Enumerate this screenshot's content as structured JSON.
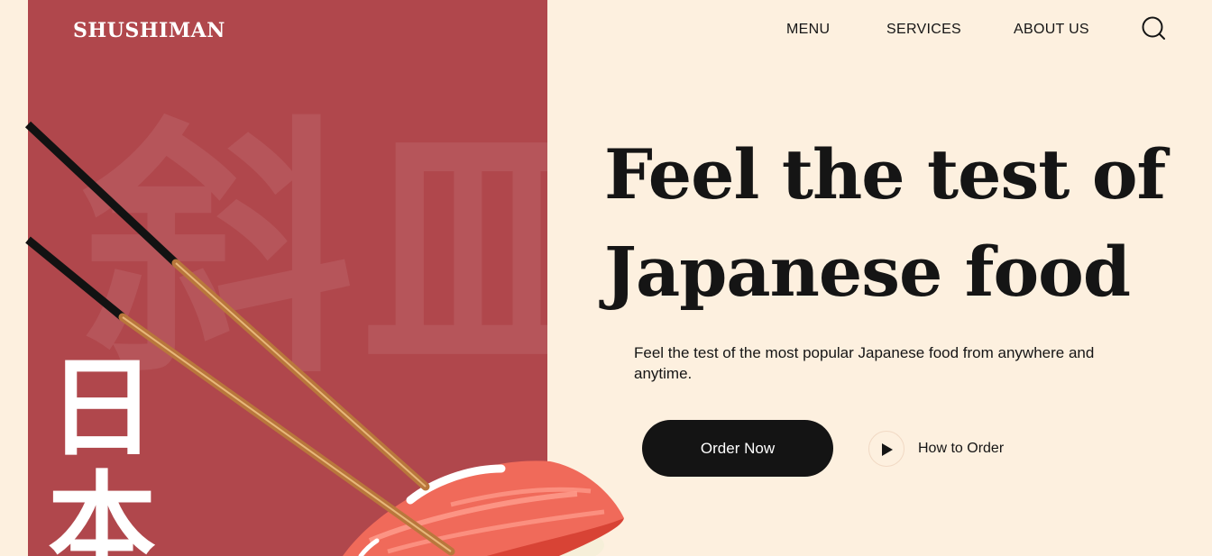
{
  "brand": {
    "logo": "SHUSHIMAN"
  },
  "nav": {
    "items": [
      {
        "label": "MENU"
      },
      {
        "label": "SERVICES"
      },
      {
        "label": "ABOUT US"
      }
    ],
    "search_icon": "search-icon"
  },
  "decor": {
    "background_kanji_1": "斜",
    "background_kanji_2": "皿",
    "vertical_kanji": [
      "日",
      "本"
    ]
  },
  "hero": {
    "title_line_1": "Feel the test of",
    "title_line_2": "Japanese food",
    "subtitle": "Feel the test of the most popular Japanese food from anywhere and anytime.",
    "primary_button": "Order Now",
    "secondary_link": "How to Order",
    "play_icon": "play-icon"
  },
  "colors": {
    "background": "#fdf0df",
    "panel": "#b0474c",
    "dark": "#141414",
    "text": "#151515",
    "white": "#ffffff"
  }
}
